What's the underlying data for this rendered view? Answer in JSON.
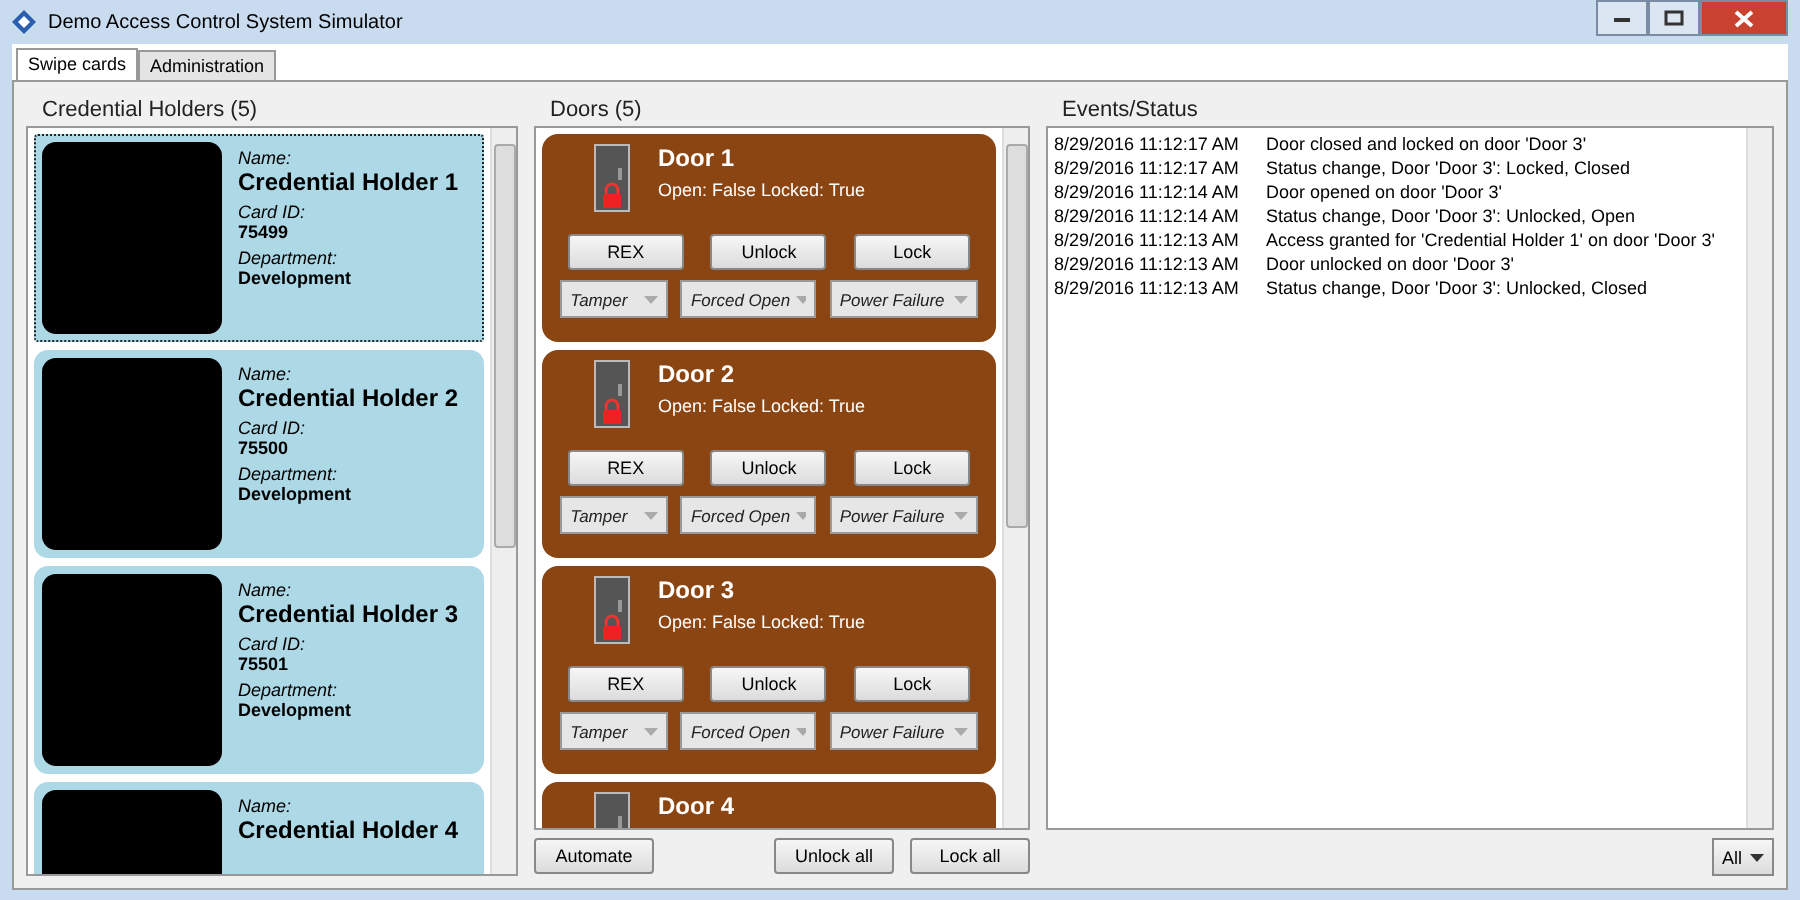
{
  "window": {
    "title": "Demo Access Control System Simulator"
  },
  "tabs": [
    {
      "label": "Swipe cards",
      "selected": true
    },
    {
      "label": "Administration",
      "selected": false
    }
  ],
  "credential_holders": {
    "title": "Credential Holders (5)",
    "items": [
      {
        "name_label": "Name:",
        "name": "Credential Holder 1",
        "card_id_label": "Card ID:",
        "card_id": "75499",
        "department_label": "Department:",
        "department": "Development",
        "selected": true
      },
      {
        "name_label": "Name:",
        "name": "Credential Holder 2",
        "card_id_label": "Card ID:",
        "card_id": "75500",
        "department_label": "Department:",
        "department": "Development",
        "selected": false
      },
      {
        "name_label": "Name:",
        "name": "Credential Holder 3",
        "card_id_label": "Card ID:",
        "card_id": "75501",
        "department_label": "Department:",
        "department": "Development",
        "selected": false
      },
      {
        "name_label": "Name:",
        "name": "Credential Holder 4",
        "selected": false
      }
    ]
  },
  "doors": {
    "title": "Doors (5)",
    "items": [
      {
        "name": "Door 1",
        "status": "Open: False Locked: True",
        "locked": true,
        "buttons": [
          "REX",
          "Unlock",
          "Lock"
        ],
        "dropdowns": [
          "Tamper",
          "Forced Open",
          "Power Failure"
        ]
      },
      {
        "name": "Door 2",
        "status": "Open: False Locked: True",
        "locked": true,
        "buttons": [
          "REX",
          "Unlock",
          "Lock"
        ],
        "dropdowns": [
          "Tamper",
          "Forced Open",
          "Power Failure"
        ]
      },
      {
        "name": "Door 3",
        "status": "Open: False Locked: True",
        "locked": true,
        "buttons": [
          "REX",
          "Unlock",
          "Lock"
        ],
        "dropdowns": [
          "Tamper",
          "Forced Open",
          "Power Failure"
        ]
      },
      {
        "name": "Door 4"
      }
    ],
    "automate_button": "Automate",
    "unlock_all_button": "Unlock all",
    "lock_all_button": "Lock all"
  },
  "events": {
    "title": "Events/Status",
    "rows": [
      {
        "time": "8/29/2016 11:12:17 AM",
        "message": "Door closed and locked on door 'Door 3'"
      },
      {
        "time": "8/29/2016 11:12:17 AM",
        "message": "Status change, Door 'Door 3': Locked, Closed"
      },
      {
        "time": "8/29/2016 11:12:14 AM",
        "message": "Door opened on door 'Door 3'"
      },
      {
        "time": "8/29/2016 11:12:14 AM",
        "message": "Status change, Door 'Door 3': Unlocked, Open"
      },
      {
        "time": "8/29/2016 11:12:13 AM",
        "message": "Access granted for 'Credential Holder 1' on door 'Door 3'"
      },
      {
        "time": "8/29/2016 11:12:13 AM",
        "message": "Door unlocked on door 'Door 3'"
      },
      {
        "time": "8/29/2016 11:12:13 AM",
        "message": "Status change, Door 'Door 3': Unlocked, Closed"
      }
    ],
    "filter": "All"
  }
}
